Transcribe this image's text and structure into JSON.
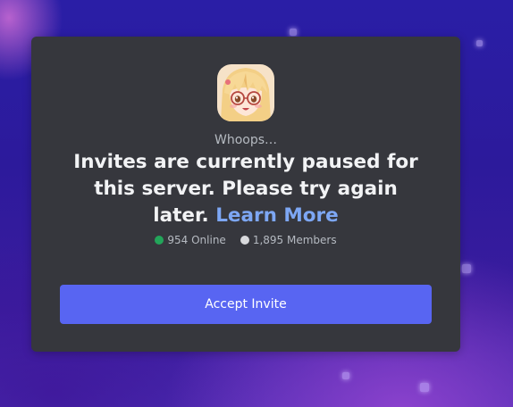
{
  "invite": {
    "subtitle": "Whoops…",
    "message": "Invites are currently paused for this server. Please try again later.",
    "learn_more_label": "Learn More",
    "online_count_label": "954 Online",
    "member_count_label": "1,895 Members",
    "accept_button_label": "Accept Invite"
  },
  "colors": {
    "card_background": "#36373d",
    "button": "#5865f2",
    "link": "#7da7f4",
    "online_dot": "#23a55a",
    "members_dot": "#d8d9dc"
  },
  "icons": {
    "server_icon": "anime-girl-avatar"
  }
}
